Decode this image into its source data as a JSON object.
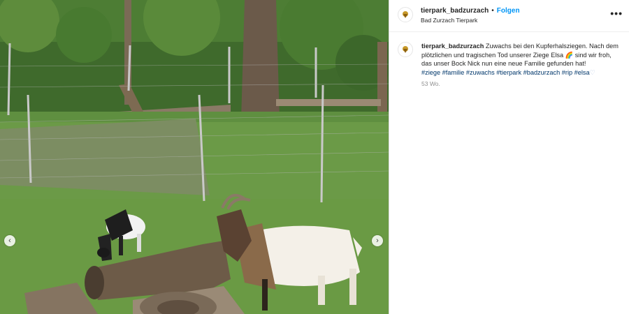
{
  "post": {
    "username": "tierpark_badzurzach",
    "separator": "•",
    "follow_label": "Folgen",
    "location": "Bad Zurzach Tierpark",
    "more_label": "•••"
  },
  "caption": {
    "username": "tierpark_badzurzach",
    "line1": "Zuwachs bei den Kupferhalsziegen. Nach dem",
    "line2": "plötzlichen und tragischen Tod unserer Ziege Elsa",
    "rainbow": "🌈",
    "line2b": "sind wir froh,",
    "line3": "das unser Bock Nick nun eine neue Familie gefunden hat!",
    "hashtags": [
      "#ziege",
      "#familie",
      "#zuwachs",
      "#tierpark",
      "#badzurzach",
      "#rip",
      "#elsa"
    ],
    "heart": "♡",
    "timestamp": "53 Wo."
  },
  "carousel": {
    "prev": "‹",
    "next": "›"
  },
  "colors": {
    "follow": "#0095f6",
    "hashtag": "#00376b",
    "muted": "#8e8e8e"
  }
}
